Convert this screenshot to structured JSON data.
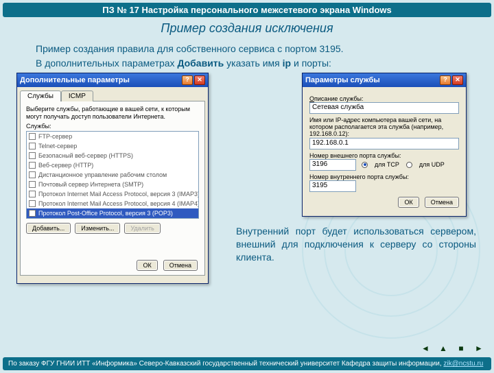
{
  "header": {
    "title": "ПЗ № 17 Настройка персонального межсетевого экрана Windows"
  },
  "subtitle": "Пример создания исключения",
  "body": {
    "p1": "Пример создания правила для собственного сервиса с портом 3195.",
    "p2a": "В дополнительных параметрах ",
    "p2b": "Добавить",
    "p2c": " указать имя ",
    "p2d": "ip",
    "p2e": " и порты:"
  },
  "dlg1": {
    "title": "Дополнительные параметры",
    "tabs": {
      "services": "Службы",
      "icmp": "ICMP"
    },
    "hint": "Выберите службы, работающие в вашей сети, к которым могут получать доступ пользователи Интернета.",
    "list_label": "Службы:",
    "items": [
      "FTP-сервер",
      "Telnet-сервер",
      "Безопасный веб-сервер (HTTPS)",
      "Веб-сервер (HTTP)",
      "Дистанционное управление рабочим столом",
      "Почтовый сервер Интернета (SMTP)",
      "Протокол Internet Mail Access Protocol, версия 3 (IMAP3)",
      "Протокол Internet Mail Access Protocol, версия 4 (IMAP4)",
      "Протокол Post-Office Protocol, версия 3 (POP3)"
    ],
    "selected_index": 8,
    "buttons": {
      "add": "Добавить...",
      "edit": "Изменить...",
      "del": "Удалить"
    },
    "ok": "ОК",
    "cancel": "Отмена"
  },
  "dlg2": {
    "title": "Параметры службы",
    "desc_label": "Описание службы:",
    "desc_value": "Сетевая служба",
    "host_label": "Имя или IP-адрес компьютера вашей сети, на котором располагается эта служба (например, 192.168.0.12):",
    "host_value": "192.168.0.1",
    "ext_label": "Номер внешнего порта службы:",
    "ext_value": "3196",
    "radios": {
      "tcp": "для TCP",
      "udp": "для UDP"
    },
    "int_label": "Номер внутреннего порта службы:",
    "int_value": "3195",
    "ok": "ОК",
    "cancel": "Отмена"
  },
  "note": "Внутренний порт будет использоваться сервером, внешний для подключения к серверу со стороны клиента.",
  "footer": {
    "text": "По заказу ФГУ ГНИИ ИТТ «Информика» Северо-Кавказский государственный технический университет Кафедра защиты информации, ",
    "mail": "zik@ncstu.ru"
  },
  "nav": {
    "prev": "◄",
    "up": "▲",
    "home": "■",
    "next": "►"
  }
}
